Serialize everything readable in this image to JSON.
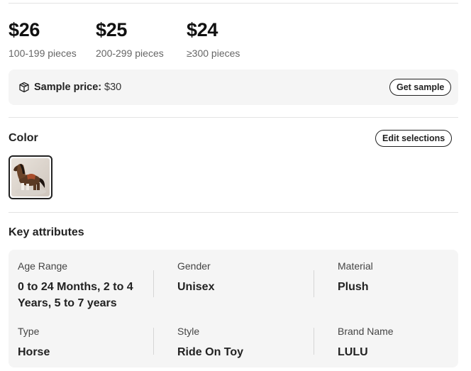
{
  "price_tiers": [
    {
      "price": "$26",
      "range": "100-199 pieces"
    },
    {
      "price": "$25",
      "range": "200-299 pieces"
    },
    {
      "price": "$24",
      "range": "≥300 pieces"
    }
  ],
  "sample": {
    "icon": "box-icon",
    "label": "Sample price:",
    "value": "$30",
    "button_label": "Get sample"
  },
  "color_section": {
    "title": "Color",
    "edit_button_label": "Edit selections",
    "swatches": [
      {
        "image": "rocking-horse-toy-thumbnail",
        "selected": true
      }
    ]
  },
  "key_attributes": {
    "title": "Key attributes",
    "items": [
      {
        "label": "Age Range",
        "value": "0 to 24 Months, 2 to 4 Years, 5 to 7 years"
      },
      {
        "label": "Gender",
        "value": "Unisex"
      },
      {
        "label": "Material",
        "value": "Plush"
      },
      {
        "label": "Type",
        "value": "Horse"
      },
      {
        "label": "Style",
        "value": "Ride On Toy"
      },
      {
        "label": "Brand Name",
        "value": "LULU"
      }
    ]
  },
  "colors": {
    "text_primary": "#222222",
    "text_secondary": "#666666",
    "panel_bg": "#f5f5f5",
    "divider": "#e3e3e3"
  }
}
